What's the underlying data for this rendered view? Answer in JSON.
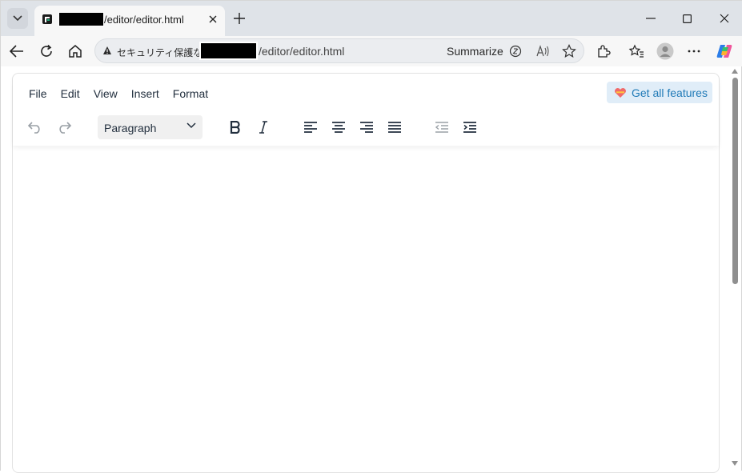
{
  "browser": {
    "tab": {
      "title_visible": "/editor/editor.html"
    },
    "address": {
      "security_label": "セキュリティ保護なし",
      "url_visible": "/editor/editor.html",
      "summarize_label": "Summarize"
    }
  },
  "editor": {
    "menu": [
      "File",
      "Edit",
      "View",
      "Insert",
      "Format"
    ],
    "get_features_label": "Get all features",
    "block_format": "Paragraph"
  },
  "colors": {
    "accent": "#207ab7",
    "accent_bg": "#e0edf8",
    "text": "#222f3e"
  },
  "icons": {
    "toolbar": [
      "undo-icon",
      "redo-icon",
      "bold-icon",
      "italic-icon",
      "align-left-icon",
      "align-center-icon",
      "align-right-icon",
      "align-justify-icon",
      "outdent-icon",
      "indent-icon"
    ]
  }
}
